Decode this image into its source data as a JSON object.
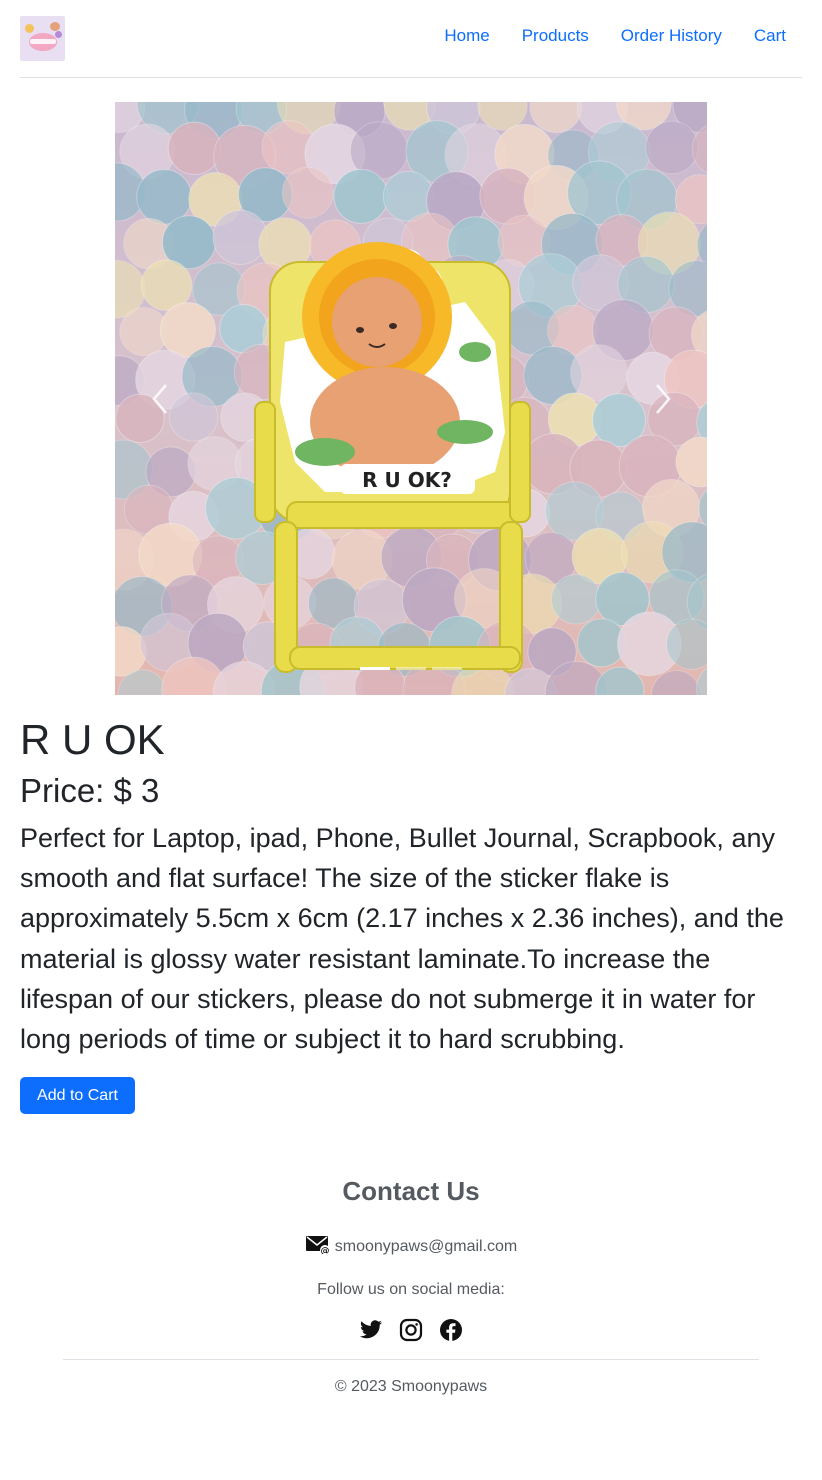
{
  "brand": {
    "logo_icon": "smoonypaws-logo"
  },
  "nav": {
    "links": [
      {
        "label": "Home"
      },
      {
        "label": "Products"
      },
      {
        "label": "Order History"
      },
      {
        "label": "Cart"
      }
    ]
  },
  "carousel": {
    "slide_count": 3,
    "active_index": 0,
    "sticker_text": "R U OK?",
    "prev_icon": "chevron-left-icon",
    "next_icon": "chevron-right-icon"
  },
  "product": {
    "name": "R U OK",
    "price_text": "Price: $ 3",
    "description": "Perfect for Laptop, ipad, Phone, Bullet Journal, Scrapbook, any smooth and flat surface! The size of the sticker flake is approximately 5.5cm x 6cm (2.17 inches x 2.36 inches), and the material is glossy water resistant laminate.To increase the lifespan of our stickers, please do not submerge it in water for long periods of time or subject it to hard scrubbing.",
    "add_to_cart_label": "Add to Cart"
  },
  "footer": {
    "contact_title": "Contact Us",
    "email": "smoonypaws@gmail.com",
    "follow_text": "Follow us on social media:",
    "social_icons": [
      "twitter-icon",
      "instagram-icon",
      "facebook-icon"
    ],
    "copyright": "© 2023 Smoonypaws"
  },
  "colors": {
    "primary": "#0d6efd",
    "text": "#212529",
    "muted": "#555a60",
    "border": "#dee2e6"
  }
}
